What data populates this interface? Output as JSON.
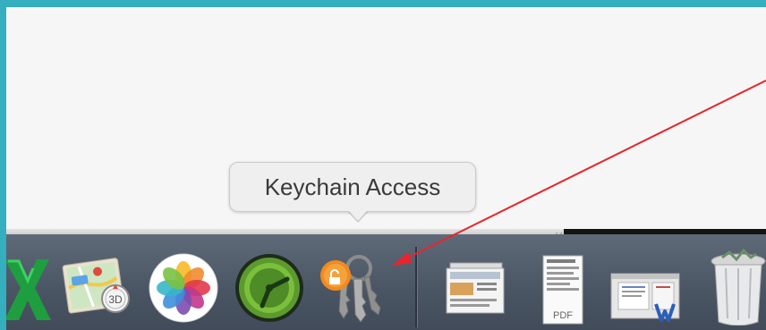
{
  "tooltip": {
    "text": "Keychain Access"
  },
  "dock": {
    "items": [
      {
        "name": "excel-icon",
        "label": "Microsoft Excel"
      },
      {
        "name": "maps-icon",
        "label": "Maps"
      },
      {
        "name": "photos-icon",
        "label": "Photos"
      },
      {
        "name": "dashboard-icon",
        "label": "Dashboard"
      },
      {
        "name": "keychain-access-icon",
        "label": "Keychain Access"
      },
      {
        "name": "preview-stack-icon",
        "label": "Documents"
      },
      {
        "name": "pdf-document-icon",
        "label": "PDF"
      },
      {
        "name": "word-document-icon",
        "label": "Word document"
      },
      {
        "name": "trash-icon",
        "label": "Trash"
      }
    ],
    "maps_badge": "3D",
    "pdf_badge": "PDF"
  },
  "colors": {
    "desktop_border": "#35aebd",
    "annotation_arrow": "#e8252c",
    "dock_background": "#4a5564"
  }
}
